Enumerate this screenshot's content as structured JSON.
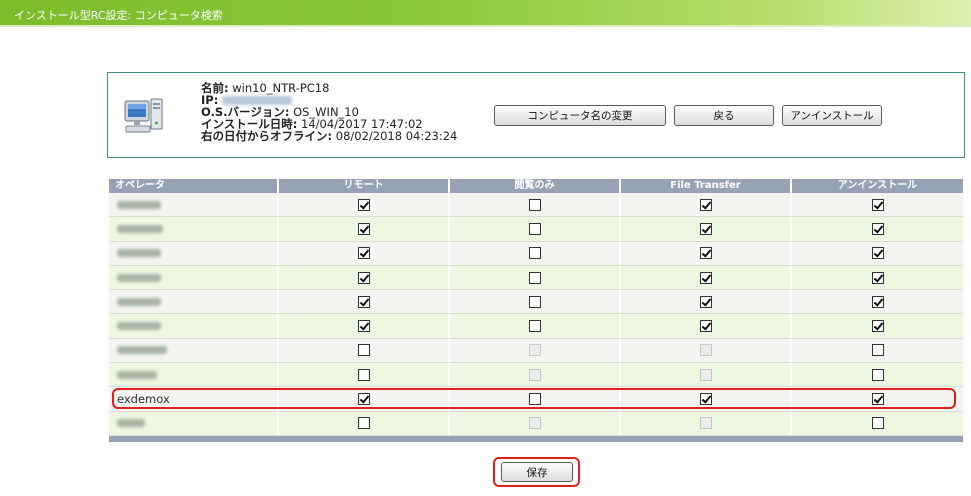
{
  "header": {
    "title": "インストール型RC設定: コンピュータ検索"
  },
  "computer": {
    "name_label": "名前:",
    "name_value": "win10_NTR-PC18",
    "ip_label": "IP:",
    "os_label": "O.S.バージョン:",
    "os_value": "OS_WIN_10",
    "install_label": "インストール日時:",
    "install_value": "14/04/2017 17:47:02",
    "offline_label": "右の日付からオフライン:",
    "offline_value": "08/02/2018 04:23:24"
  },
  "buttons": {
    "rename": "コンピュータ名の変更",
    "back": "戻る",
    "uninstall": "アンインストール",
    "save": "保存"
  },
  "table": {
    "headers": [
      "オペレータ",
      "リモート",
      "閲覧のみ",
      "File Transfer",
      "アンインストール"
    ],
    "rows": [
      {
        "name": "",
        "remote": true,
        "view": false,
        "view_disabled": false,
        "transfer": true,
        "transfer_disabled": false,
        "uninstall": true
      },
      {
        "name": "",
        "remote": true,
        "view": false,
        "view_disabled": false,
        "transfer": true,
        "transfer_disabled": false,
        "uninstall": true
      },
      {
        "name": "",
        "remote": true,
        "view": false,
        "view_disabled": false,
        "transfer": true,
        "transfer_disabled": false,
        "uninstall": true
      },
      {
        "name": "",
        "remote": true,
        "view": false,
        "view_disabled": false,
        "transfer": true,
        "transfer_disabled": false,
        "uninstall": true
      },
      {
        "name": "",
        "remote": true,
        "view": false,
        "view_disabled": false,
        "transfer": true,
        "transfer_disabled": false,
        "uninstall": true
      },
      {
        "name": "",
        "remote": true,
        "view": false,
        "view_disabled": false,
        "transfer": true,
        "transfer_disabled": false,
        "uninstall": true
      },
      {
        "name": "",
        "remote": false,
        "view": false,
        "view_disabled": true,
        "transfer": false,
        "transfer_disabled": true,
        "uninstall": false
      },
      {
        "name": "",
        "remote": false,
        "view": false,
        "view_disabled": true,
        "transfer": false,
        "transfer_disabled": true,
        "uninstall": false
      },
      {
        "name": "exdemox",
        "remote": true,
        "view": false,
        "view_disabled": false,
        "transfer": true,
        "transfer_disabled": false,
        "uninstall": true
      },
      {
        "name": "",
        "remote": false,
        "view": false,
        "view_disabled": true,
        "transfer": false,
        "transfer_disabled": true,
        "uninstall": false
      }
    ]
  },
  "icons": {
    "computer": "computer-icon",
    "checkbox": "checkbox-icon"
  }
}
